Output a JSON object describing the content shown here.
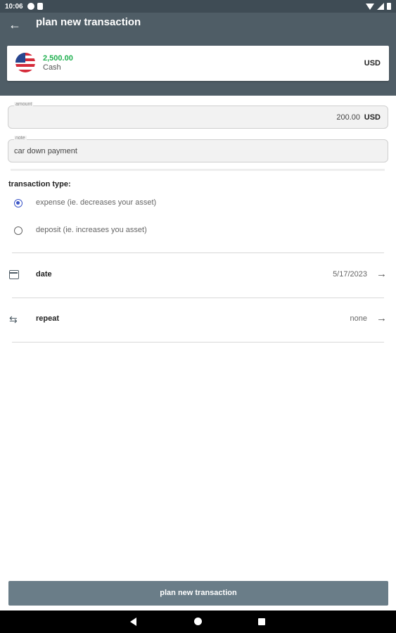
{
  "status_bar": {
    "time": "10:06"
  },
  "header": {
    "title": "plan new transaction",
    "back_icon": "arrow-back-icon"
  },
  "account": {
    "amount": "2,500.00",
    "name": "Cash",
    "currency": "USD",
    "flag_icon": "us-flag-icon",
    "amount_color": "#1fb04f"
  },
  "amount_field": {
    "label": "amount",
    "value": "200.00",
    "currency": "USD"
  },
  "note_field": {
    "label": "note",
    "value": "car down payment"
  },
  "transaction_type": {
    "label": "transaction type:",
    "selected": "expense",
    "options": [
      {
        "label": "expense (ie. decreases your asset)",
        "checked": true
      },
      {
        "label": "deposit (ie. increases you asset)",
        "checked": false
      }
    ]
  },
  "date_row": {
    "title": "date",
    "value": "5/17/2023",
    "icon": "calendar-icon"
  },
  "repeat_row": {
    "title": "repeat",
    "value": "none",
    "icon": "repeat-icon"
  },
  "submit_button": {
    "label": "plan new transaction"
  },
  "colors": {
    "header": "#4f5d66",
    "status_bar": "#3f4c55",
    "button": "#6a7d88",
    "radio_accent": "#3b55c7"
  }
}
